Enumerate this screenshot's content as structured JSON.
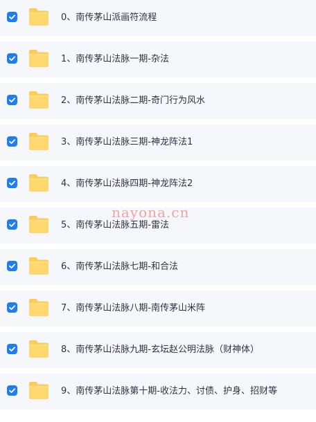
{
  "files": [
    {
      "name": "0、南传茅山派画符流程"
    },
    {
      "name": "1、南传茅山法脉一期-杂法"
    },
    {
      "name": "2、南传茅山法脉二期-奇门行为风水"
    },
    {
      "name": "3、南传茅山法脉三期-神龙阵法1"
    },
    {
      "name": "4、南传茅山法脉四期-神龙阵法2"
    },
    {
      "name": "5、南传茅山法脉五期-雷法"
    },
    {
      "name": "6、南传茅山法脉七期-和合法"
    },
    {
      "name": "7、南传茅山法脉八期-南传茅山米阵"
    },
    {
      "name": "8、南传茅山法脉九期-玄坛赵公明法脉（财神体）"
    },
    {
      "name": "9、南传茅山法脉第十期-收法力、讨债、护身、招财等"
    }
  ],
  "watermark": "nayona.cn",
  "colors": {
    "row_background": "#f6f7fb",
    "checkbox": "#1f7df2",
    "folder": "#ffd46b",
    "text": "#2f3340",
    "watermark": "#ef9fa0"
  },
  "icons": {
    "checkbox": "checkbox-checked-icon",
    "folder": "folder-icon"
  }
}
